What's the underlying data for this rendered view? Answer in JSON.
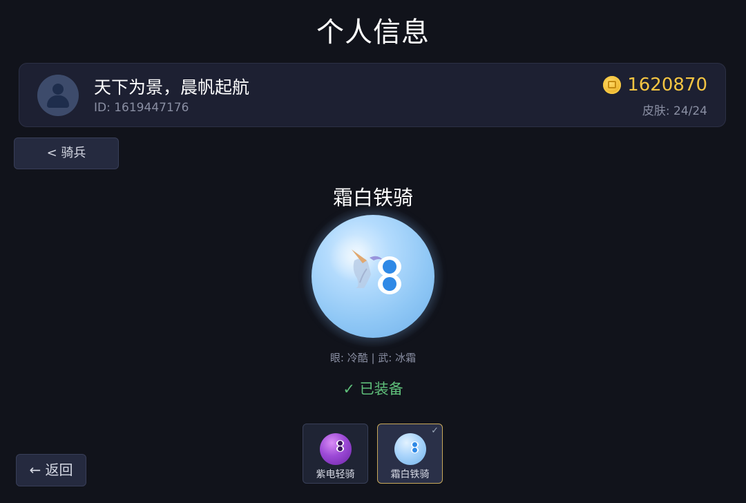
{
  "header": {
    "title": "个人信息"
  },
  "profile": {
    "name": "天下为景，晨帆起航",
    "id_label": "ID: 1619447176",
    "coins": "1620870",
    "skins_label": "皮肤: 24/24",
    "avatar_icon": "user-icon",
    "coin_icon": "coin-icon",
    "coin_color": "#f5c542"
  },
  "category": {
    "label": "< 骑兵"
  },
  "skin_detail": {
    "name": "霜白铁骑",
    "attributes": "眼: 冷酷  |  武: 冰霜",
    "status": "✓ 已装备",
    "status_color": "#5fbf7a",
    "ball_color": "#8fc7f5",
    "emblem_icon": "unicorn-icon"
  },
  "skin_list": [
    {
      "label": "紫电轻骑",
      "color": "#8e3fc9",
      "selected": false
    },
    {
      "label": "霜白铁骑",
      "color": "#8fc7f5",
      "selected": true,
      "check_glyph": "✓"
    }
  ],
  "footer": {
    "back_label": "← 返回"
  }
}
